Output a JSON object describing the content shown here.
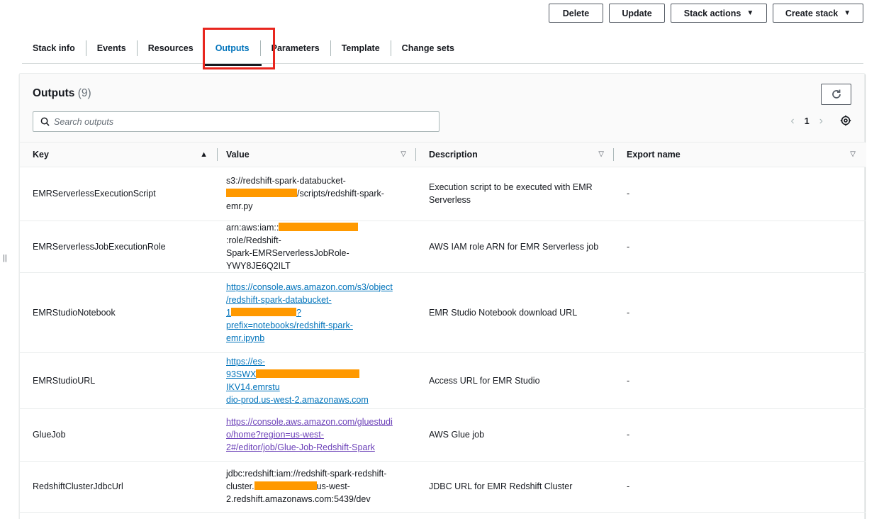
{
  "actions": {
    "delete": "Delete",
    "update": "Update",
    "stack_actions": "Stack actions",
    "create_stack": "Create stack"
  },
  "tabs": [
    {
      "label": "Stack info"
    },
    {
      "label": "Events"
    },
    {
      "label": "Resources"
    },
    {
      "label": "Outputs"
    },
    {
      "label": "Parameters"
    },
    {
      "label": "Template"
    },
    {
      "label": "Change sets"
    }
  ],
  "active_tab": "Outputs",
  "panel": {
    "title": "Outputs",
    "count": "(9)",
    "search_placeholder": "Search outputs",
    "page": "1"
  },
  "table": {
    "columns": [
      "Key",
      "Value",
      "Description",
      "Export name"
    ],
    "rows": [
      {
        "key": "EMRServerlessExecutionScript",
        "value_parts": [
          "s3://redshift-spark-databucket-",
          "/scripts/redshift-spark-",
          "emr.py"
        ],
        "description": "Execution script to be executed with EMR Serverless",
        "export": "-"
      },
      {
        "key": "EMRServerlessJobExecutionRole",
        "value_parts": [
          "arn:aws:iam::",
          ":role/Redshift-",
          "Spark-EMRServerlessJobRole-",
          "YWY8JE6Q2ILT"
        ],
        "description": "AWS IAM role ARN for EMR Serverless job",
        "export": "-"
      },
      {
        "key": "EMRStudioNotebook",
        "value_parts": [
          "https://console.aws.amazon.com/s3/object",
          "/redshift-spark-databucket-",
          "1",
          "?",
          "prefix=notebooks/redshift-spark-",
          "emr.ipynb"
        ],
        "description": "EMR Studio Notebook download URL",
        "export": "-"
      },
      {
        "key": "EMRStudioURL",
        "value_parts": [
          "https://es-",
          "93SWX",
          "IKV14.emrstu",
          "dio-prod.us-west-2.amazonaws.com"
        ],
        "description": "Access URL for EMR Studio",
        "export": "-"
      },
      {
        "key": "GlueJob",
        "value_parts": [
          "https://console.aws.amazon.com/gluestudi",
          "o/home?region=us-west-",
          "2#/editor/job/Glue-Job-Redshift-Spark"
        ],
        "description": "AWS Glue job",
        "export": "-"
      },
      {
        "key": "RedshiftClusterJdbcUrl",
        "value_parts": [
          "jdbc:redshift:iam://redshift-spark-redshift-",
          "cluster.",
          "us-west-",
          "2.redshift.amazonaws.com:5439/dev"
        ],
        "description": "JDBC URL for EMR Redshift Cluster",
        "export": "-"
      }
    ]
  },
  "colors": {
    "link": "#0073bb",
    "visited_link": "#6b40b8",
    "highlight": "#e8261e",
    "redaction": "#ff9900"
  },
  "icons": {
    "refresh": "refresh-icon",
    "search": "search-icon",
    "settings": "gear-icon",
    "sort_asc": "sort-ascending-icon",
    "sort": "sort-icon"
  }
}
